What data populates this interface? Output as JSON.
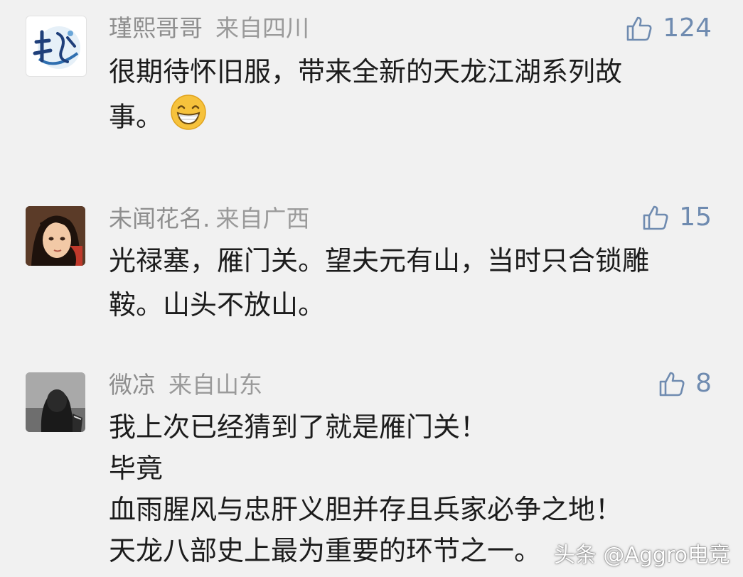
{
  "comments": [
    {
      "username": "瑾熙哥哥",
      "location": "来自四川",
      "likes": "124",
      "avatar_icon": "calligraphy-logo-avatar",
      "lines": [
        "很期待怀旧服，带来全新的天龙江湖系列故",
        "事。"
      ],
      "emoji": "grinning-face-emoji"
    },
    {
      "username": "未闻花名.",
      "location": "来自广西",
      "likes": "15",
      "avatar_icon": "anime-girl-avatar",
      "lines": [
        "光禄塞，雁门关。望夫元有山，当时只合锁雕",
        "鞍。山头不放山。"
      ]
    },
    {
      "username": "微凉",
      "location": "来自山东",
      "likes": "8",
      "avatar_icon": "hooded-figure-avatar",
      "lines": [
        "我上次已经猜到了就是雁门关！",
        "毕竟",
        "血雨腥风与忠肝义胆并存且兵家必争之地！",
        "天龙八部史上最为重要的环节之一。"
      ]
    }
  ],
  "watermark": "头条 @Aggro电竞",
  "colors": {
    "background": "#f1f1f1",
    "meta": "#8e8e8e",
    "like": "#6f8bb0",
    "text": "#1c1c1c"
  }
}
